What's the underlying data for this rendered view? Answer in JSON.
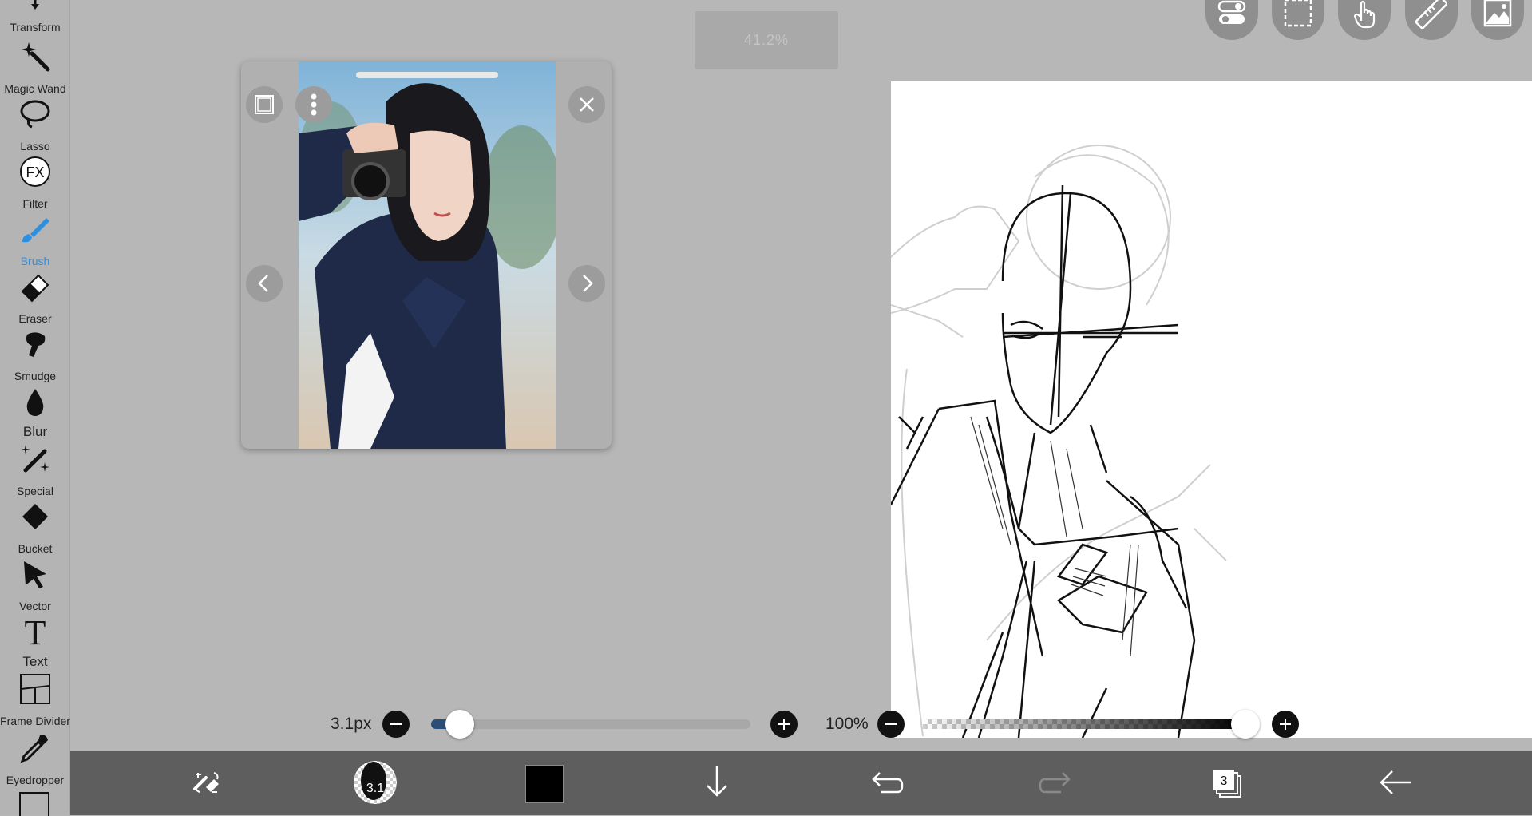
{
  "left_toolbar": {
    "tools": [
      {
        "label": "Transform",
        "icon": "transform-icon"
      },
      {
        "label": "Magic Wand",
        "icon": "magic-wand-icon"
      },
      {
        "label": "Lasso",
        "icon": "lasso-icon"
      },
      {
        "label": "Filter",
        "icon": "filter-fx-icon",
        "glyph": "FX"
      },
      {
        "label": "Brush",
        "icon": "brush-icon",
        "active": true
      },
      {
        "label": "Eraser",
        "icon": "eraser-icon"
      },
      {
        "label": "Smudge",
        "icon": "smudge-icon"
      },
      {
        "label": "Blur",
        "icon": "blur-drop-icon"
      },
      {
        "label": "Special",
        "icon": "special-brush-icon"
      },
      {
        "label": "Bucket",
        "icon": "bucket-icon"
      },
      {
        "label": "Vector",
        "icon": "vector-arrow-icon"
      },
      {
        "label": "Text",
        "icon": "text-icon",
        "glyph": "T"
      },
      {
        "label": "Frame Divider",
        "icon": "frame-divider-icon"
      },
      {
        "label": "Eyedropper",
        "icon": "eyedropper-icon"
      }
    ],
    "active_color": "#2d8fe0"
  },
  "zoom_indicator": "41.2%",
  "top_buttons": [
    "toggle-settings-icon",
    "selection-icon",
    "touch-hand-icon",
    "ruler-icon",
    "reference-image-icon"
  ],
  "reference_window": {
    "icons": [
      "fit-frame-icon",
      "more-vertical-icon",
      "close-icon",
      "chevron-left-icon",
      "chevron-right-icon"
    ]
  },
  "brush_size": {
    "label": "3.1px",
    "fraction": 0.09
  },
  "brush_opacity": {
    "label": "100%",
    "fraction": 1.0
  },
  "bottom_bar": {
    "brush_preview_size": "3.1",
    "layer_count": "3",
    "current_color": "#000000",
    "icons": [
      "swap-tools-icon",
      "brush-preview-icon",
      "color-swatch",
      "download-icon",
      "undo-icon",
      "redo-icon",
      "layers-icon",
      "back-arrow-icon"
    ]
  }
}
